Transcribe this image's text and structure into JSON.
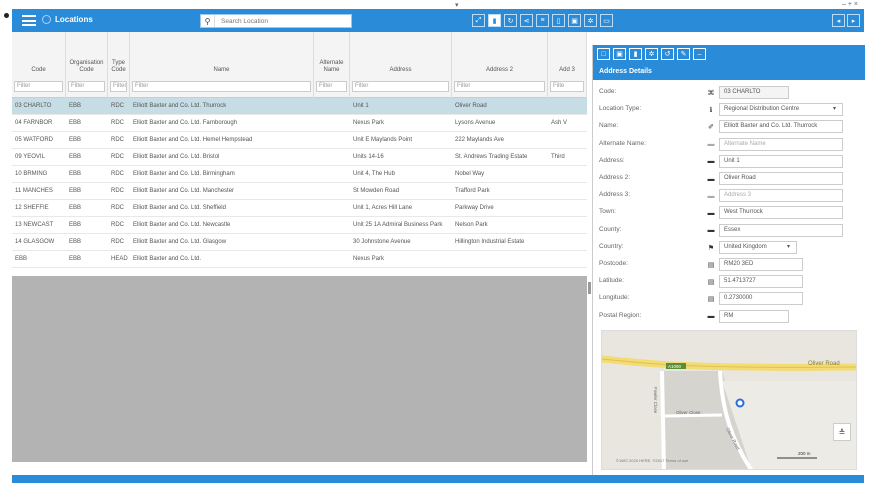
{
  "app": {
    "title": "Locations"
  },
  "search": {
    "placeholder": "Search Location"
  },
  "window": {
    "controls": "– + ×"
  },
  "columns": [
    {
      "label": "Code",
      "filter": "Filter"
    },
    {
      "label": "Organisation Code",
      "filter": "Filter"
    },
    {
      "label": "Type Code",
      "filter": "Filter"
    },
    {
      "label": "Name",
      "filter": "Filter"
    },
    {
      "label": "Alternate Name",
      "filter": "Filter"
    },
    {
      "label": "Address",
      "filter": "Filter"
    },
    {
      "label": "Address 2",
      "filter": "Filter"
    },
    {
      "label": "Add 3",
      "filter": "Filte"
    }
  ],
  "rows": [
    [
      "03 CHARLTO",
      "EBB",
      "RDC",
      "Elliott Baxter and Co. Ltd. Thurrock",
      "",
      "Unit 1",
      "Oliver Road",
      ""
    ],
    [
      "04 FARNBOR",
      "EBB",
      "RDC",
      "Elliott Baxter and Co. Ltd. Farnborough",
      "",
      "Nexus Park",
      "Lysons Avenue",
      "Ash V"
    ],
    [
      "05 WATFORD",
      "EBB",
      "RDC",
      "Elliott Baxter and Co. Ltd. Hemel Hempstead",
      "",
      "Unit E Maylands Point",
      "222 Maylands Ave",
      ""
    ],
    [
      "09 YEOVIL",
      "EBB",
      "RDC",
      "Elliott Baxter and Co. Ltd. Bristol",
      "",
      "Units 14-16",
      "St. Andrews Trading Estate",
      "Third"
    ],
    [
      "10 BRMING",
      "EBB",
      "RDC",
      "Elliott Baxter and Co. Ltd. Birmingham",
      "",
      "Unit 4, The Hub",
      "Nobel Way",
      ""
    ],
    [
      "11 MANCHES",
      "EBB",
      "RDC",
      "Elliott Baxter and Co. Ltd. Manchester",
      "",
      "St Mowden Road",
      "Trafford Park",
      ""
    ],
    [
      "12 SHEFFIE",
      "EBB",
      "RDC",
      "Elliott Baxter and Co. Ltd. Sheffield",
      "",
      "Unit 1, Acres Hill Lane",
      "Parkway Drive",
      ""
    ],
    [
      "13 NEWCAST",
      "EBB",
      "RDC",
      "Elliott Baxter and Co. Ltd. Newcastle",
      "",
      "Unit 25 1A Admiral Business Park",
      "Nelson Park",
      ""
    ],
    [
      "14 GLASGOW",
      "EBB",
      "RDC",
      "Elliott Baxter and Co. Ltd. Glasgow",
      "",
      "30 Johnstone Avenue",
      "Hillington Industrial Estate",
      ""
    ],
    [
      "EBB",
      "EBB",
      "HEAD",
      "Elliott Baxter and Co. Ltd.",
      "",
      "Nexus Park",
      "",
      ""
    ]
  ],
  "panel": {
    "title": "Address Details",
    "fields": [
      {
        "label": "Code:",
        "value": "03 CHARLTO",
        "icon": "hash-icon",
        "glyph": "⌘",
        "placeholder": false,
        "readonly": true
      },
      {
        "label": "Location Type:",
        "value": "Regional Distribution Centre",
        "icon": "info-icon",
        "glyph": "ℹ",
        "placeholder": false,
        "readonly": false,
        "dropdown": true
      },
      {
        "label": "Name:",
        "value": "Elliott Baxter and Co. Ltd. Thurrock",
        "icon": "tag-icon",
        "glyph": "✐",
        "placeholder": false,
        "readonly": false
      },
      {
        "label": "Alternate Name:",
        "value": "Alternate Name",
        "icon": "card-icon",
        "glyph": "▬",
        "placeholder": true,
        "readonly": false
      },
      {
        "label": "Address:",
        "value": "Unit 1",
        "icon": "card-icon",
        "glyph": "▬",
        "placeholder": false,
        "readonly": false
      },
      {
        "label": "Address 2:",
        "value": "Oliver Road",
        "icon": "card-icon",
        "glyph": "▬",
        "placeholder": false,
        "readonly": false
      },
      {
        "label": "Address 3:",
        "value": "Address 3",
        "icon": "card-icon",
        "glyph": "▬",
        "placeholder": true,
        "readonly": false
      },
      {
        "label": "Town:",
        "value": "West Thurrock",
        "icon": "card-icon",
        "glyph": "▬",
        "placeholder": false,
        "readonly": false
      },
      {
        "label": "County:",
        "value": "Essex",
        "icon": "card-icon",
        "glyph": "▬",
        "placeholder": false,
        "readonly": false
      },
      {
        "label": "Country:",
        "value": "United Kingdom",
        "icon": "flag-icon",
        "glyph": "⚑",
        "placeholder": false,
        "readonly": false,
        "dropdown": true
      },
      {
        "label": "Postcode:",
        "value": "RM20 3ED",
        "icon": "doc-icon",
        "glyph": "▤",
        "placeholder": false,
        "readonly": false
      },
      {
        "label": "Latitude:",
        "value": "51.4713727",
        "icon": "doc-icon",
        "glyph": "▤",
        "placeholder": false,
        "readonly": false
      },
      {
        "label": "Longitude:",
        "value": "0.2730000",
        "icon": "doc-icon",
        "glyph": "▤",
        "placeholder": false,
        "readonly": false
      },
      {
        "label": "Postal Region:",
        "value": "RM",
        "icon": "card-icon",
        "glyph": "▬",
        "placeholder": false,
        "readonly": false
      }
    ]
  },
  "map": {
    "road_main": "Oliver Road",
    "road_badge": "A1090",
    "road_side1": "Oliver Close",
    "road_side2": "Oliver Road",
    "road_vert": "Fowler Close",
    "scale": "200 m",
    "attribution": "©1987-2020 HERE, ©2017 Terms of use"
  },
  "colors": {
    "accent": "#2a8bd8",
    "selected_row": "#c7dde6"
  }
}
